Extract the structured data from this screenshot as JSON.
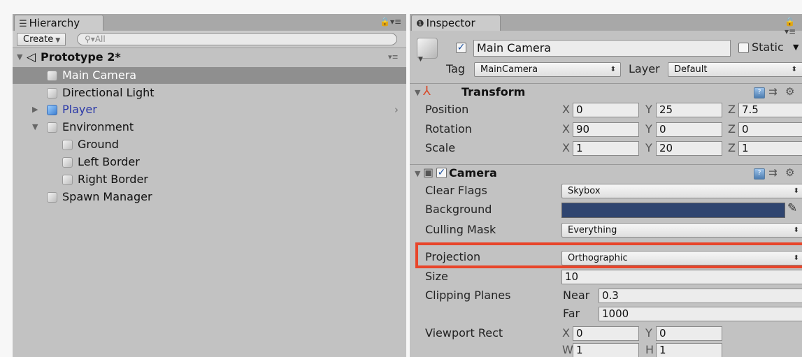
{
  "hierarchy": {
    "tab_label": "Hierarchy",
    "tab_icon": "list-icon",
    "create_label": "Create",
    "search_placeholder": "All",
    "scene_name": "Prototype 2*",
    "items": [
      {
        "label": "Main Camera",
        "icon": "gameobject-cube-icon",
        "selected": true
      },
      {
        "label": "Directional Light",
        "icon": "gameobject-cube-icon"
      },
      {
        "label": "Player",
        "icon": "prefab-cube-icon",
        "color": "#2b39a8"
      },
      {
        "label": "Environment",
        "icon": "gameobject-cube-icon"
      },
      {
        "label": "Ground",
        "icon": "gameobject-cube-icon"
      },
      {
        "label": "Left Border",
        "icon": "gameobject-cube-icon"
      },
      {
        "label": "Right Border",
        "icon": "gameobject-cube-icon"
      },
      {
        "label": "Spawn Manager",
        "icon": "gameobject-cube-icon"
      }
    ]
  },
  "inspector": {
    "tab_label": "Inspector",
    "tab_icon": "info-icon",
    "object_name": "Main Camera",
    "static_label": "Static",
    "tag_label": "Tag",
    "tag_value": "MainCamera",
    "layer_label": "Layer",
    "layer_value": "Default",
    "transform": {
      "title": "Transform",
      "position": {
        "label": "Position",
        "x": "0",
        "y": "25",
        "z": "7.5"
      },
      "rotation": {
        "label": "Rotation",
        "x": "90",
        "y": "0",
        "z": "0"
      },
      "scale": {
        "label": "Scale",
        "x": "1",
        "y": "20",
        "z": "1"
      }
    },
    "camera": {
      "title": "Camera",
      "clear_flags": {
        "label": "Clear Flags",
        "value": "Skybox"
      },
      "background": {
        "label": "Background",
        "color": "#2f4570"
      },
      "culling_mask": {
        "label": "Culling Mask",
        "value": "Everything"
      },
      "projection": {
        "label": "Projection",
        "value": "Orthographic"
      },
      "size": {
        "label": "Size",
        "value": "10"
      },
      "clipping_planes": {
        "label": "Clipping Planes",
        "near_label": "Near",
        "near": "0.3",
        "far_label": "Far",
        "far": "1000"
      },
      "viewport_rect": {
        "label": "Viewport Rect",
        "x": "0",
        "y": "0",
        "w": "1",
        "h": "1"
      }
    }
  },
  "axis_labels": {
    "x": "X",
    "y": "Y",
    "z": "Z",
    "w": "W",
    "h": "H"
  },
  "highlight_color": "#e8452a"
}
